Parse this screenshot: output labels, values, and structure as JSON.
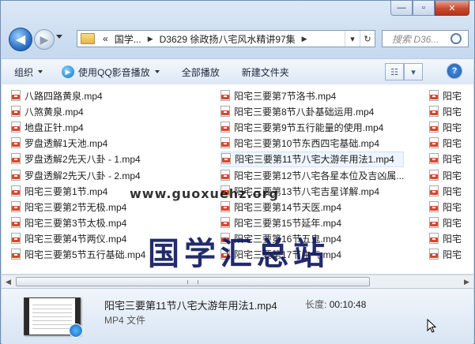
{
  "window": {
    "minimize": "—",
    "maximize": "▫",
    "close": "✕"
  },
  "nav": {
    "back_glyph": "◀",
    "forward_glyph": "▶",
    "breadcrumbs": [
      "«",
      "国学...",
      "D3629 徐政扬八宅风水精讲97集"
    ],
    "search_placeholder": "搜索 D36..."
  },
  "toolbar": {
    "organize": "组织",
    "qq_play": "使用QQ影音播放",
    "play_all": "全部播放",
    "new_folder": "新建文件夹"
  },
  "files": {
    "col1": [
      "八路四路黄泉.mp4",
      "八煞黄泉.mp4",
      "地盘正针.mp4",
      "罗盘透解1天池.mp4",
      "罗盘透解2先天八卦 - 1.mp4",
      "罗盘透解2先天八卦 - 2.mp4",
      "阳宅三要第1节.mp4",
      "阳宅三要第2节无极.mp4",
      "阳宅三要第3节太极.mp4",
      "阳宅三要第4节两仪.mp4",
      "阳宅三要第5节五行基础.mp4"
    ],
    "col2": [
      "阳宅三要第7节洛书.mp4",
      "阳宅三要第8节八卦基础运用.mp4",
      "阳宅三要第9节五行能量的使用.mp4",
      "阳宅三要第10节东西四宅基础.mp4",
      "阳宅三要第11节八宅大游年用法1.mp4",
      "阳宅三要第12节八宅各星本位及吉凶属...",
      "阳宅三要第13节八宅吉星详解.mp4",
      "阳宅三要第14节天医.mp4",
      "阳宅三要第15节延年.mp4",
      "阳宅三要第16节五鬼.mp4",
      "阳宅三要第17节生气.mp4"
    ],
    "col3": [
      "阳宅",
      "阳宅",
      "阳宅",
      "阳宅",
      "阳宅",
      "阳宅",
      "阳宅",
      "阳宅",
      "阳宅",
      "阳宅",
      "阳宅"
    ]
  },
  "details": {
    "filename": "阳宅三要第11节八宅大游年用法1.mp4",
    "length_label": "长度:",
    "length_value": "00:10:48",
    "type": "MP4 文件"
  },
  "watermark": {
    "title": "国学汇总站",
    "url": "www.guoxuehz.org"
  }
}
